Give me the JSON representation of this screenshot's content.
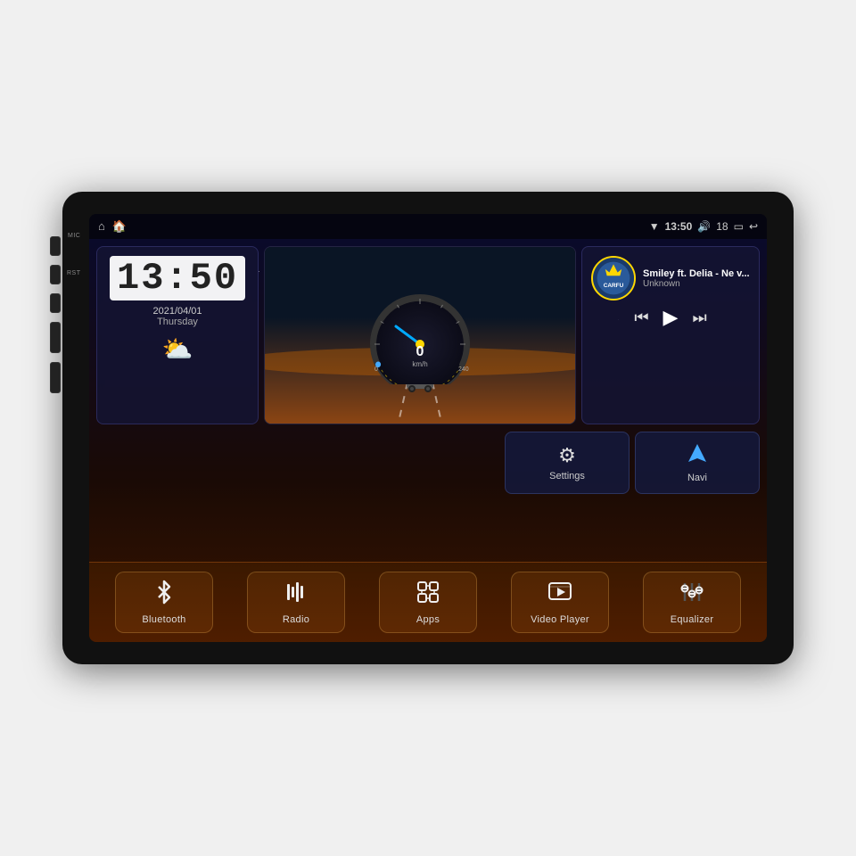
{
  "device": {
    "micLabel": "MIC",
    "rstLabel": "RST"
  },
  "statusBar": {
    "leftIcons": [
      "🏠",
      "🏠"
    ],
    "time": "13:50",
    "volume": "18",
    "rightIcons": [
      "wifi",
      "volume",
      "battery",
      "back"
    ]
  },
  "clock": {
    "time": "13:50",
    "date": "2021/04/01",
    "day": "Thursday",
    "weatherIcon": "⛅"
  },
  "music": {
    "title": "Smiley ft. Delia - Ne v...",
    "artist": "Unknown",
    "albumText": "CARFU"
  },
  "widgets": {
    "settings": {
      "label": "Settings",
      "icon": "⚙"
    },
    "navi": {
      "label": "Navi",
      "icon": "▲"
    }
  },
  "dock": [
    {
      "id": "bluetooth",
      "label": "Bluetooth",
      "icon": "bluetooth"
    },
    {
      "id": "radio",
      "label": "Radio",
      "icon": "radio"
    },
    {
      "id": "apps",
      "label": "Apps",
      "icon": "apps"
    },
    {
      "id": "video-player",
      "label": "Video Player",
      "icon": "video"
    },
    {
      "id": "equalizer",
      "label": "Equalizer",
      "icon": "equalizer"
    }
  ],
  "gauge": {
    "speed": "0",
    "unit": "km/h",
    "maxSpeed": "240"
  }
}
